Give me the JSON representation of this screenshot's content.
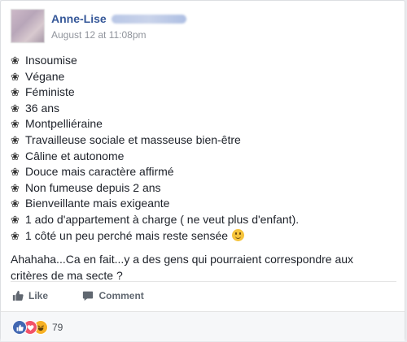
{
  "post": {
    "author_first_name": "Anne-Lise",
    "timestamp": "August 12 at 11:08pm",
    "bullet_glyph": "❀",
    "items": [
      "Insoumise",
      "Végane",
      "Féministe",
      "36 ans",
      "Montpelliéraine",
      "Travailleuse sociale et masseuse bien-être",
      "Câline et autonome",
      "Douce mais caractère affirmé",
      "Non fumeuse depuis 2 ans",
      "Bienveillante mais exigeante",
      "1 ado d'appartement à charge ( ne veut plus d'enfant).",
      "1 côté un peu perché mais reste sensée"
    ],
    "closing_text": "Ahahaha...Ca en fait...y a des gens qui pourraient correspondre aux critères de ma secte ?"
  },
  "actions": {
    "like_label": "Like",
    "comment_label": "Comment"
  },
  "reactions": {
    "types": [
      "like",
      "love",
      "haha"
    ],
    "count": "79"
  },
  "colors": {
    "link": "#365899",
    "like_blue": "#4267b2",
    "love_red": "#f25268",
    "haha_yellow": "#f7b125"
  }
}
